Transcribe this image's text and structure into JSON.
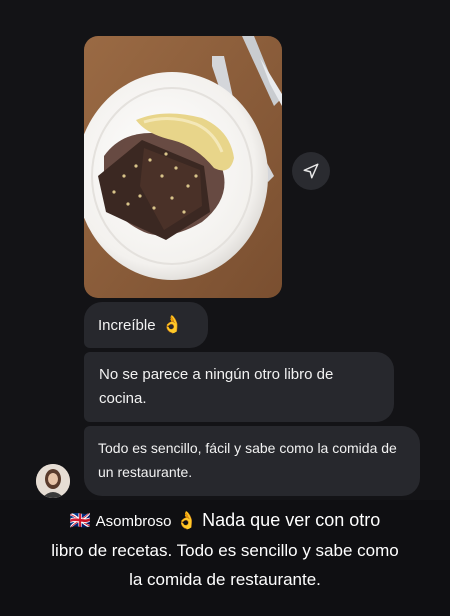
{
  "messages": [
    {
      "text": "Increíble",
      "emoji": "👌"
    },
    {
      "text": "No se parece a ningún otro libro de cocina."
    },
    {
      "text": "Todo es sencillo, fácil y sabe como la comida de un restaurante."
    }
  ],
  "caption": {
    "flag": "🇬🇧",
    "lead": "Asombroso",
    "emoji": "👌",
    "line1_rest": "Nada que ver con otro",
    "line2": "libro de recetas. Todo es sencillo y sabe como",
    "line3": "la comida de restaurante."
  },
  "icons": {
    "share": "send-icon",
    "emoji": "ok-hand-icon"
  },
  "colors": {
    "background": "#131316",
    "bubble": "#27282d",
    "text": "#f2f2f2"
  }
}
